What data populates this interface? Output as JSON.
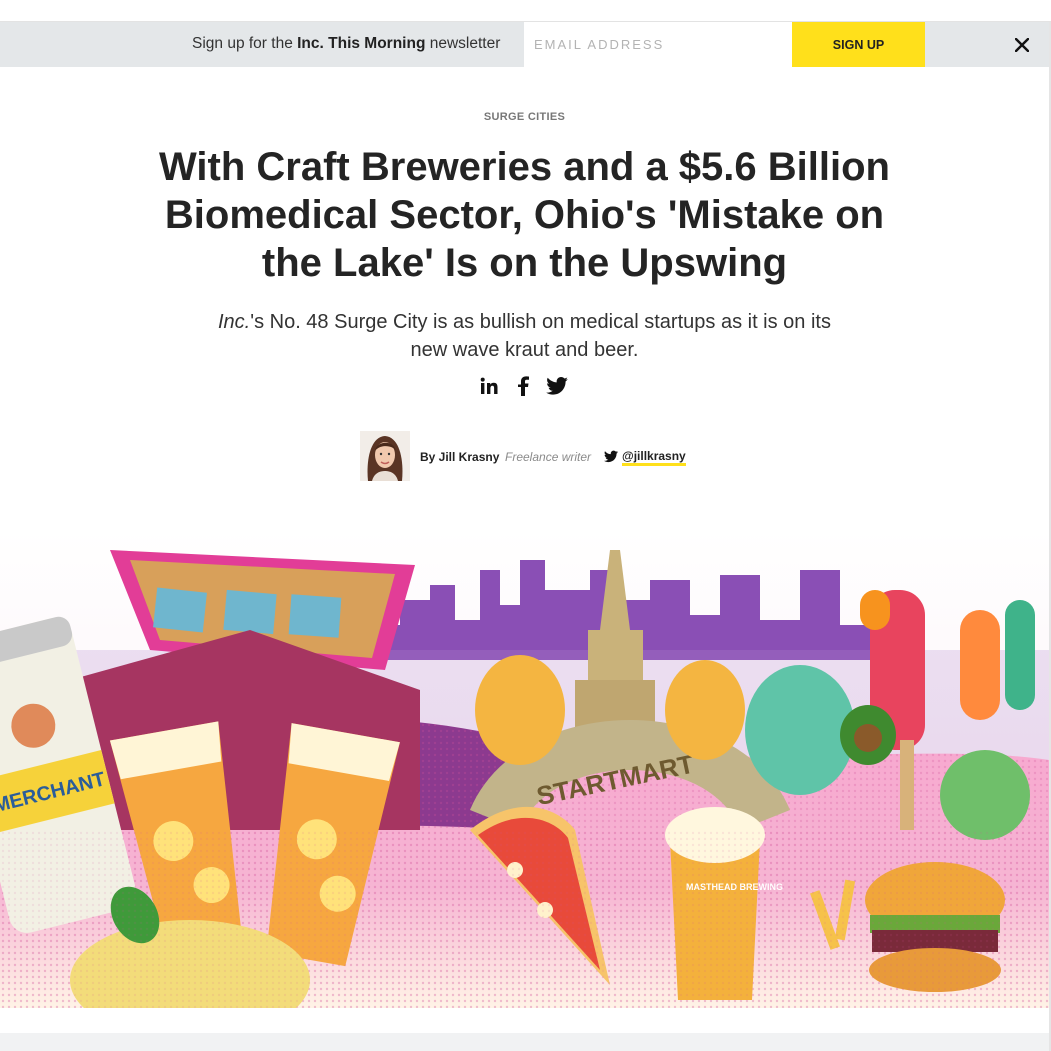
{
  "newsletter": {
    "prefix": "Sign up for the ",
    "brand": "Inc. This Morning",
    "suffix": " newsletter",
    "email_placeholder": "EMAIL ADDRESS",
    "signup_label": "SIGN UP",
    "close_glyph": "✕"
  },
  "article": {
    "kicker": "SURGE CITIES",
    "headline": "With Craft Breweries and a $5.6 Billion Biomedical Sector, Ohio's 'Mistake on the Lake' Is on the Upswing",
    "dek_italic": "Inc.",
    "dek_rest": "'s No. 48 Surge City is as bullish on medical startups as it is on its new wave kraut and beer."
  },
  "share": {
    "icons": [
      "linkedin-icon",
      "facebook-icon",
      "twitter-icon"
    ]
  },
  "byline": {
    "author": "By Jill Krasny",
    "role": "Freelance writer",
    "twitter_handle": "@jillkrasny"
  },
  "hero": {
    "sign_text": "STARTMART",
    "can_text": "MERCHANT",
    "glass_text": "MASTHEAD BREWING"
  },
  "colors": {
    "accent": "#ffe01b",
    "newsletter_bg": "#e4e7e9",
    "headline": "#242424"
  }
}
